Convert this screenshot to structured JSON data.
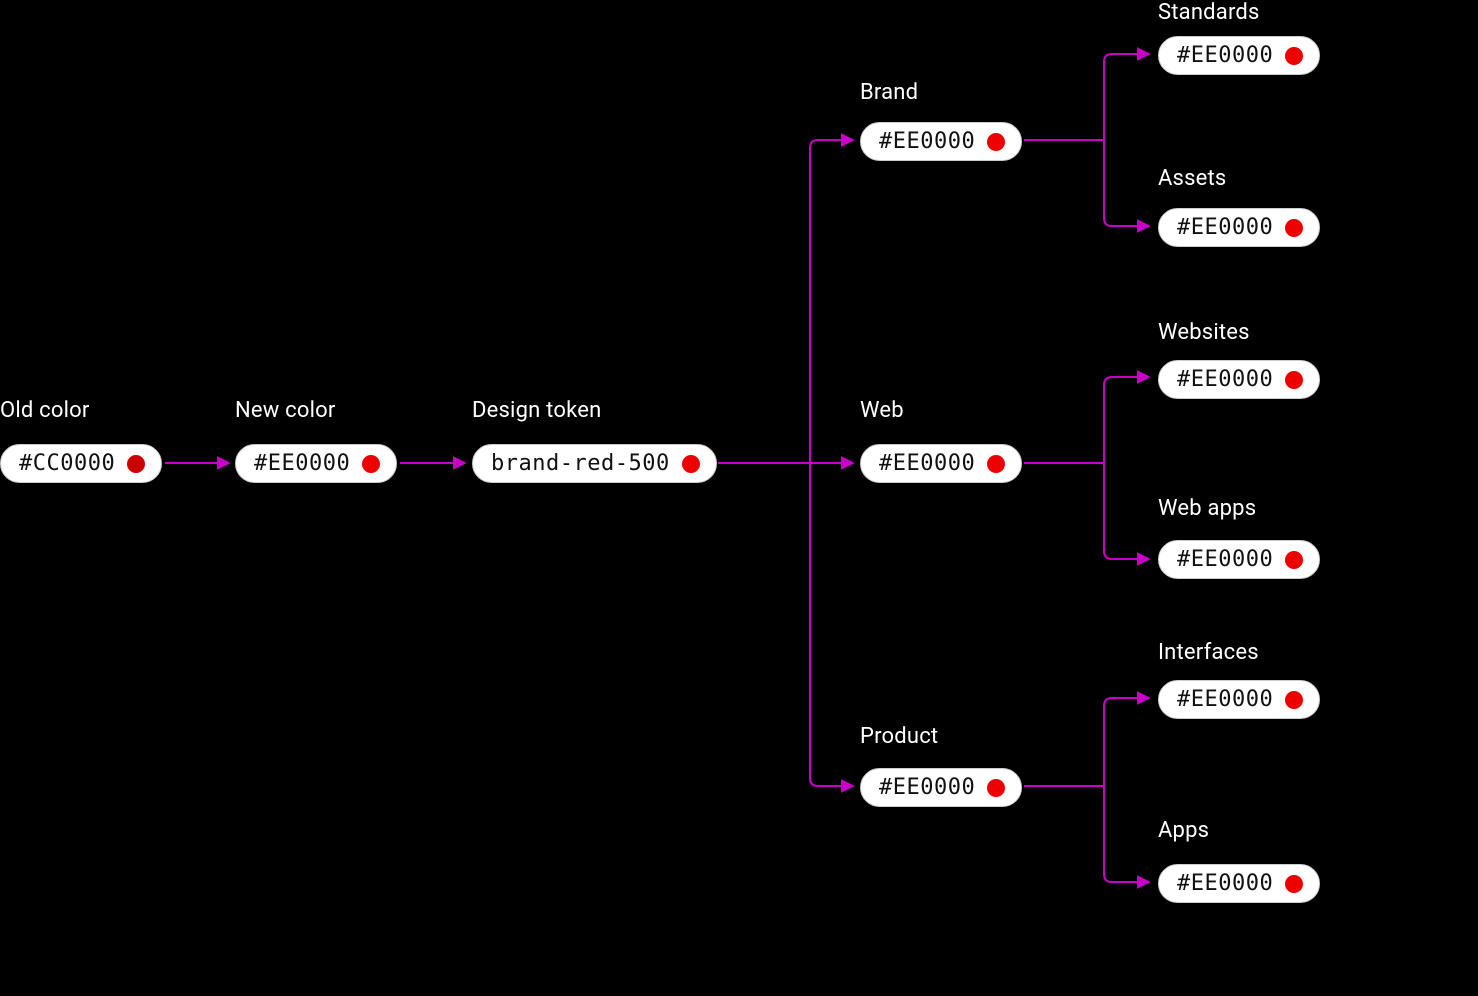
{
  "colors": {
    "old": "#CC0000",
    "new": "#EE0000",
    "connector": "#C800C8",
    "label": "#FFFFFF"
  },
  "labels": {
    "old_color": "Old color",
    "new_color": "New color",
    "design_token": "Design token",
    "brand": "Brand",
    "web": "Web",
    "product": "Product",
    "standards": "Standards",
    "assets": "Assets",
    "websites": "Websites",
    "web_apps": "Web apps",
    "interfaces": "Interfaces",
    "apps": "Apps"
  },
  "chips": {
    "old_color": "#CC0000",
    "new_color": "#EE0000",
    "design_token": "brand-red-500",
    "brand": "#EE0000",
    "web": "#EE0000",
    "product": "#EE0000",
    "standards": "#EE0000",
    "assets": "#EE0000",
    "websites": "#EE0000",
    "web_apps": "#EE0000",
    "interfaces": "#EE0000",
    "apps": "#EE0000"
  },
  "geometry": {
    "arrow_color": "#C800C8",
    "stroke_width": 2
  }
}
